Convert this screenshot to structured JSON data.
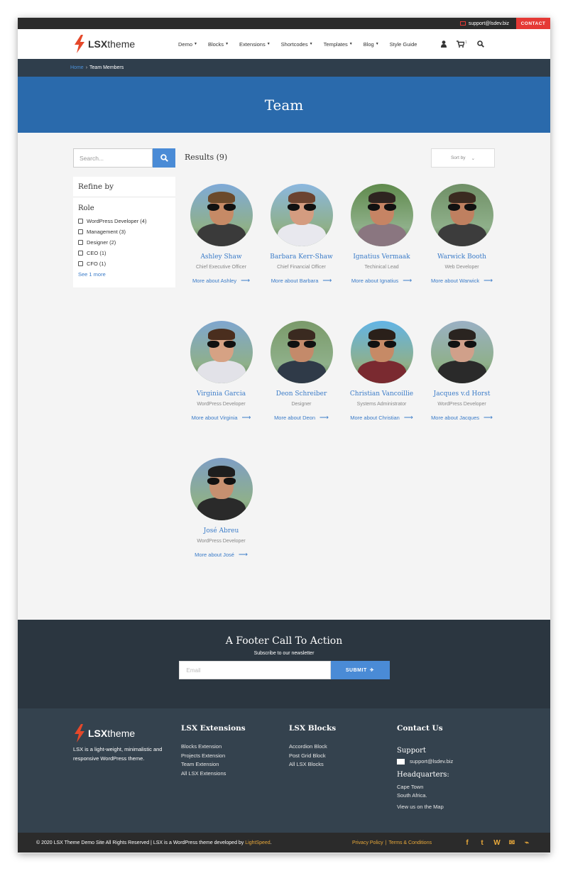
{
  "topbar": {
    "email": "support@lsdev.biz",
    "contact_label": "CONTACT"
  },
  "logo": {
    "strong": "LSX",
    "light": "theme"
  },
  "nav": {
    "items": [
      {
        "label": "Demo",
        "has_caret": true
      },
      {
        "label": "Blocks",
        "has_caret": true
      },
      {
        "label": "Extensions",
        "has_caret": true
      },
      {
        "label": "Shortcodes",
        "has_caret": true
      },
      {
        "label": "Templates",
        "has_caret": true
      },
      {
        "label": "Blog",
        "has_caret": true
      },
      {
        "label": "Style Guide",
        "has_caret": false
      }
    ],
    "icons": [
      "user-icon",
      "cart-icon",
      "search-icon"
    ],
    "cart_count": "1"
  },
  "breadcrumb": {
    "home": "Home",
    "separator": "›",
    "current": "Team Members"
  },
  "banner": {
    "title": "Team"
  },
  "sidebar": {
    "search_placeholder": "Search...",
    "refine_title": "Refine by",
    "role_title": "Role",
    "options": [
      "WordPress Developer (4)",
      "Management (3)",
      "Designer (2)",
      "CEO (1)",
      "CFO (1)"
    ],
    "see_more": "See 1 more"
  },
  "results": {
    "label": "Results (9)",
    "sort_label": "Sort by",
    "sort_caret": "⌄"
  },
  "members": [
    {
      "name": "Ashley Shaw",
      "role": "Chief Executive Officer",
      "link": "More about Ashley",
      "arrow": "⟶",
      "skin": "#c68a66",
      "shirt": "#3a3a3a",
      "hair": "#6b4a2c",
      "sky": "#7faad8"
    },
    {
      "name": "Barbara Kerr-Shaw",
      "role": "Chief Financial Officer",
      "link": "More about Barbara",
      "arrow": "⟶",
      "skin": "#d49c80",
      "shirt": "#e8e8ee",
      "hair": "#6b4330",
      "sky": "#8bb7df"
    },
    {
      "name": "Ignatius Vermaak",
      "role": "Techinical Lead",
      "link": "More about Ignatius",
      "arrow": "⟶",
      "skin": "#c68464",
      "shirt": "#8a7680",
      "hair": "#2e2420",
      "sky": "#5f8a4c"
    },
    {
      "name": "Warwick Booth",
      "role": "Web Developer",
      "link": "More about Warwick",
      "arrow": "⟶",
      "skin": "#bf8060",
      "shirt": "#3c3c3c",
      "hair": "#3a2a20",
      "sky": "#6f8f66"
    },
    {
      "name": "Virginia Garcia",
      "role": "WordPress Developer",
      "link": "More about Virginia",
      "arrow": "⟶",
      "skin": "#d6a284",
      "shirt": "#e2e2e8",
      "hair": "#4a2e1e",
      "sky": "#7fa6cf"
    },
    {
      "name": "Deon Schreiber",
      "role": "Designer",
      "link": "More about Deon",
      "arrow": "⟶",
      "skin": "#c48a6a",
      "shirt": "#2f3a48",
      "hair": "#3a2a20",
      "sky": "#7a9a6a"
    },
    {
      "name": "Christian Vancoillie",
      "role": "Systems Administrator",
      "link": "More about Christian",
      "arrow": "⟶",
      "skin": "#c68a66",
      "shirt": "#7a2a30",
      "hair": "#2a201a",
      "sky": "#62b4e6"
    },
    {
      "name": "Jacques v.d Horst",
      "role": "WordPress Developer",
      "link": "More about Jacques",
      "arrow": "⟶",
      "skin": "#d0a08a",
      "shirt": "#2a2a2a",
      "hair": "#2a2420",
      "sky": "#9ab0c4"
    },
    {
      "name": "José Abreu",
      "role": "WordPress Developer",
      "link": "More about José",
      "arrow": "⟶",
      "skin": "#c69070",
      "shirt": "#2a2a2a",
      "hair": "#1e1e1e",
      "sky": "#7e9ec4"
    }
  ],
  "cta": {
    "title": "A Footer Call To Action",
    "subtitle": "Subscribe to our newsletter",
    "email_placeholder": "Email",
    "submit_label": "SUBMIT",
    "submit_icon": "✈"
  },
  "footer": {
    "about": "LSX is a light-weight, minimalistic and responsive WordPress theme.",
    "extensions": {
      "title": "LSX Extensions",
      "links": [
        "Blocks Extension",
        "Projects Extension",
        "Team Extension",
        "All LSX Extensions"
      ]
    },
    "blocks": {
      "title": "LSX Blocks",
      "links": [
        "Accordion Block",
        "Post Grid Block",
        "All LSX Blocks"
      ]
    },
    "contact": {
      "title": "Contact Us",
      "support_label": "Support",
      "email": "support@lsdev.biz",
      "hq_label": "Headquarters:",
      "city": "Cape Town",
      "country": "South Africa.",
      "map_link": "View us on the Map"
    }
  },
  "bottom": {
    "copyright": "© 2020 LSX Theme Demo Site All Rights Reserved | LSX is a WordPress theme developed by ",
    "developer": "LightSpeed",
    "period": ".",
    "privacy": "Privacy Policy",
    "legal_sep": "|",
    "terms": "Terms & Conditions",
    "social": [
      {
        "icon": "facebook-icon",
        "glyph": "f"
      },
      {
        "icon": "twitter-icon",
        "glyph": "t"
      },
      {
        "icon": "wordpress-icon",
        "glyph": "W"
      },
      {
        "icon": "email-icon",
        "glyph": "✉"
      },
      {
        "icon": "rss-icon",
        "glyph": "⌁"
      }
    ]
  },
  "colors": {
    "accent": "#4a8bd6",
    "banner": "#2a6aac",
    "contact_red": "#e53935",
    "footer_link": "#e8a83a"
  }
}
